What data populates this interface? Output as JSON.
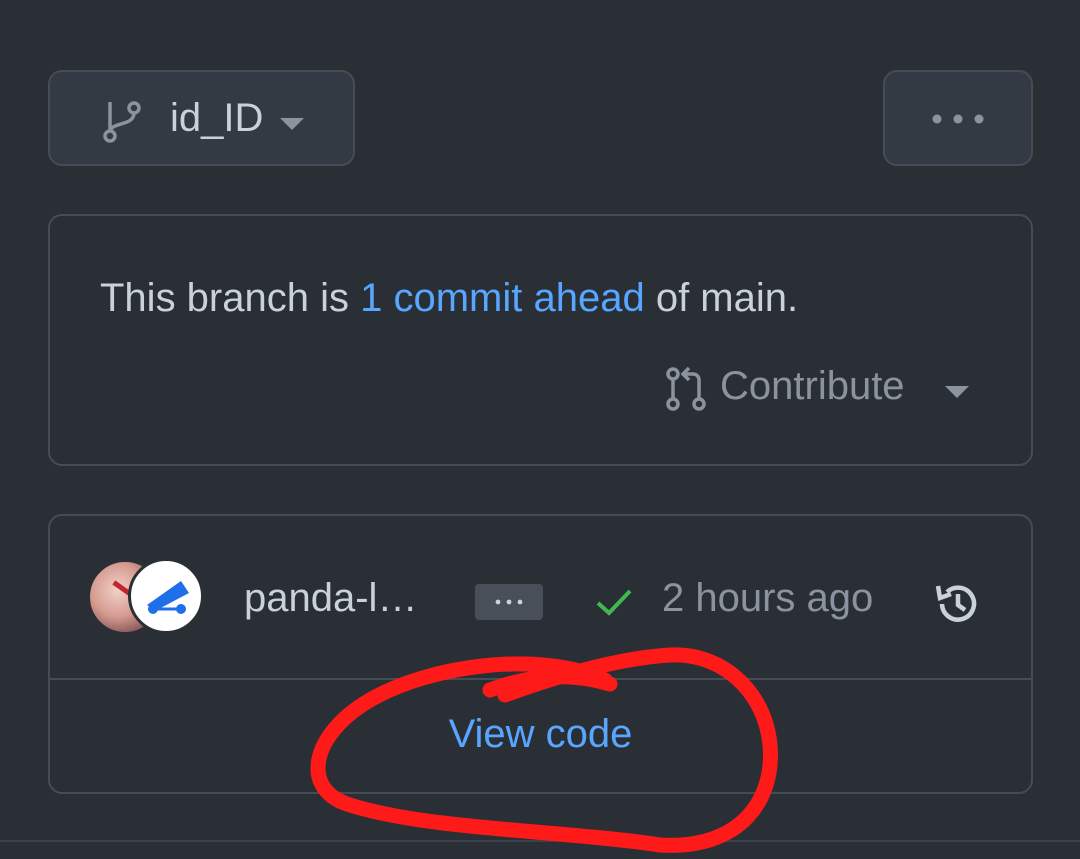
{
  "branch_selector": {
    "name": "id_ID",
    "icon": "git-branch-icon"
  },
  "more_button": {
    "icon": "kebab-horizontal-icon"
  },
  "branch_status": {
    "prefix": "This branch is ",
    "link": "1 commit ahead",
    "suffix": " of main.",
    "contribute_label": "Contribute",
    "contribute_icon": "git-pull-request-icon"
  },
  "latest_commit": {
    "author": "panda-l…",
    "ellipsis": "…",
    "status_icon": "check-icon",
    "time": "2 hours ago",
    "history_icon": "history-icon"
  },
  "view_code_label": "View code",
  "colors": {
    "background": "#2a2f36",
    "border": "#444c56",
    "link": "#58a6ff",
    "success": "#3fb950",
    "annotation": "#ff1a1a"
  }
}
